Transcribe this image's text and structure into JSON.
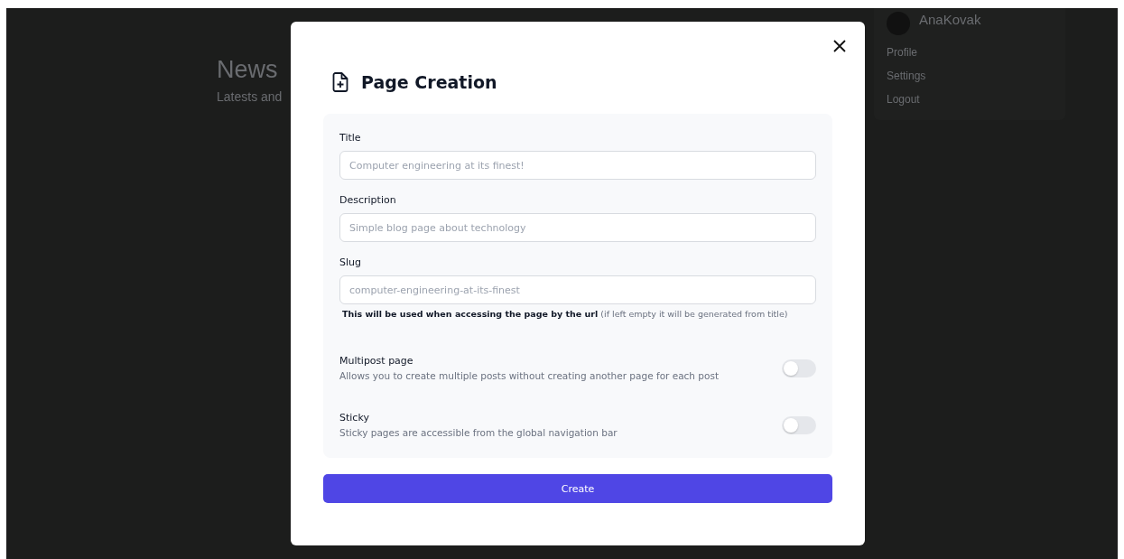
{
  "background_page": {
    "heading": "News",
    "subtitle": "Latests and"
  },
  "user_menu": {
    "username": "AnaKovak",
    "items": [
      {
        "label": "Profile"
      },
      {
        "label": "Settings"
      },
      {
        "label": "Logout"
      }
    ]
  },
  "dialog": {
    "title": "Page Creation",
    "fields": [
      {
        "label": "Title",
        "placeholder": "Computer engineering at its finest!"
      },
      {
        "label": "Description",
        "placeholder": "Simple blog page about technology"
      },
      {
        "label": "Slug",
        "placeholder": "computer-engineering-at-its-finest",
        "hint": "**This will be used when accessing the page by the url** (if left empty it will be generated from title)"
      }
    ],
    "toggles": [
      {
        "label": "Multipost page",
        "description": "Allows you to create multiple posts without creating another page for each post",
        "on": false
      },
      {
        "label": "Sticky",
        "description": "Sticky pages are accessible from the global navigation bar",
        "on": false
      }
    ],
    "submit": "Create"
  }
}
